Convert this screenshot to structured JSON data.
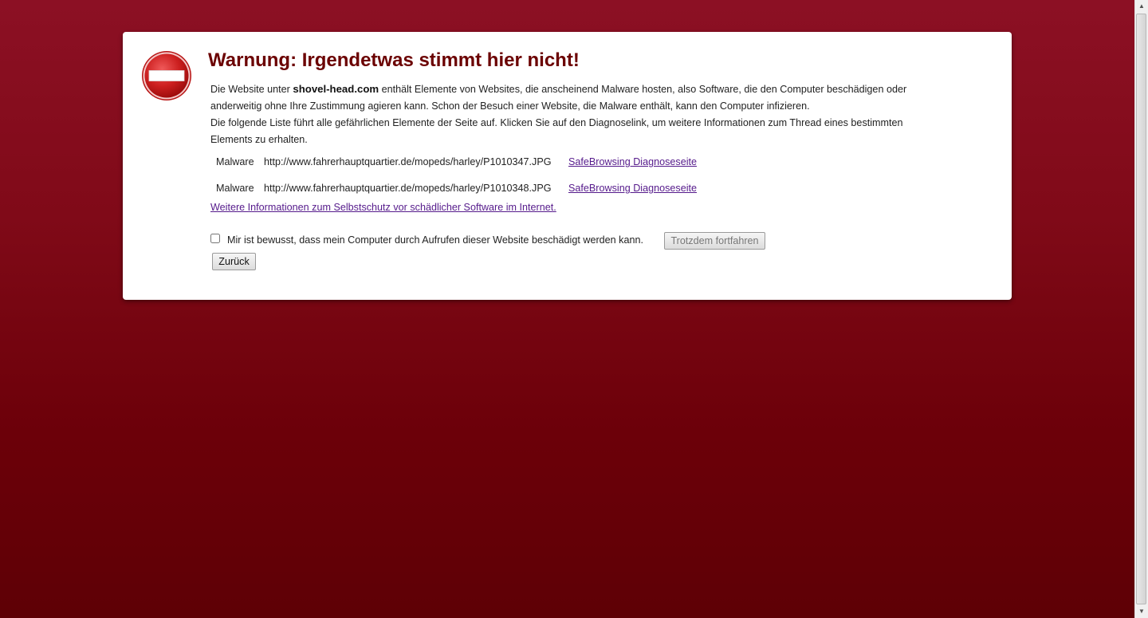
{
  "warning": {
    "title": "Warnung: Irgendetwas stimmt hier nicht!",
    "icon": "stop-icon",
    "para1_prefix": "Die Website unter ",
    "site_name": "shovel-head.com",
    "para1_suffix": " enthält Elemente von Websites, die anscheinend Malware hosten, also Software, die den Computer beschädigen oder anderweitig ohne Ihre Zustimmung agieren kann. Schon der Besuch einer Website, die Malware enthält, kann den Computer infizieren.",
    "para2": "Die folgende Liste führt alle gefährlichen Elemente der Seite auf. Klicken Sie auf den Diagnoselink, um weitere Informationen zum Thread eines bestimmten Elements zu erhalten."
  },
  "malware_list": [
    {
      "type": "Malware",
      "url": "http://www.fahrerhauptquartier.de/mopeds/harley/P1010347.JPG",
      "link": "SafeBrowsing Diagnoseseite"
    },
    {
      "type": "Malware",
      "url": "http://www.fahrerhauptquartier.de/mopeds/harley/P1010348.JPG",
      "link": "SafeBrowsing Diagnoseseite"
    }
  ],
  "more_info_link": "Weitere Informationen zum Selbstschutz vor schädlicher Software im Internet.",
  "confirm": {
    "label": "Mir ist bewusst, dass mein Computer durch Aufrufen dieser Website beschädigt werden kann.",
    "checked": false,
    "proceed_button": "Trotzdem fortfahren"
  },
  "back_button": "Zurück",
  "colors": {
    "background_top": "#8c1024",
    "background_bottom": "#5e0005",
    "title": "#6b0000",
    "link": "#551a8b",
    "stop_red": "#cc1f1f"
  }
}
